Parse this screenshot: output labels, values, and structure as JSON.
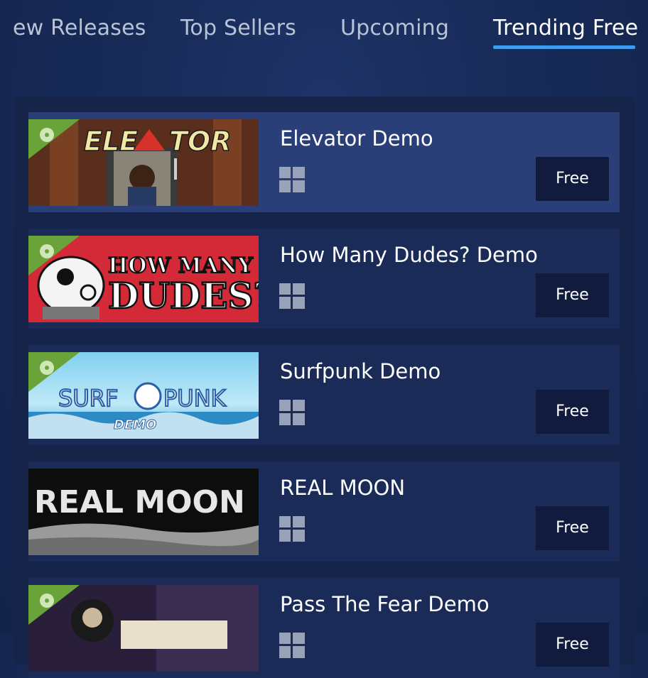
{
  "tabs": [
    {
      "label": "ew Releases",
      "active": false
    },
    {
      "label": "Top Sellers",
      "active": false
    },
    {
      "label": "Upcoming",
      "active": false
    },
    {
      "label": "Trending Free",
      "active": true
    }
  ],
  "colors": {
    "accent": "#3d9cf0",
    "demo_ribbon": "#6aa33a",
    "price_button": "#101b3d"
  },
  "items": [
    {
      "name": "Elevator Demo",
      "price": "Free",
      "platform_icon": "windows-icon",
      "demo_badge": true,
      "capsule_text": "ELEVATOR"
    },
    {
      "name": "How Many Dudes? Demo",
      "price": "Free",
      "platform_icon": "windows-icon",
      "demo_badge": true,
      "capsule_text": "HOW MANY DUDES?"
    },
    {
      "name": "Surfpunk Demo",
      "price": "Free",
      "platform_icon": "windows-icon",
      "demo_badge": true,
      "capsule_text": "SURFPUNK DEMO"
    },
    {
      "name": "REAL MOON",
      "price": "Free",
      "platform_icon": "windows-icon",
      "demo_badge": false,
      "capsule_text": "REAL MOON"
    },
    {
      "name": "Pass The Fear Demo",
      "price": "Free",
      "platform_icon": "windows-icon",
      "demo_badge": true,
      "capsule_text": ""
    }
  ]
}
